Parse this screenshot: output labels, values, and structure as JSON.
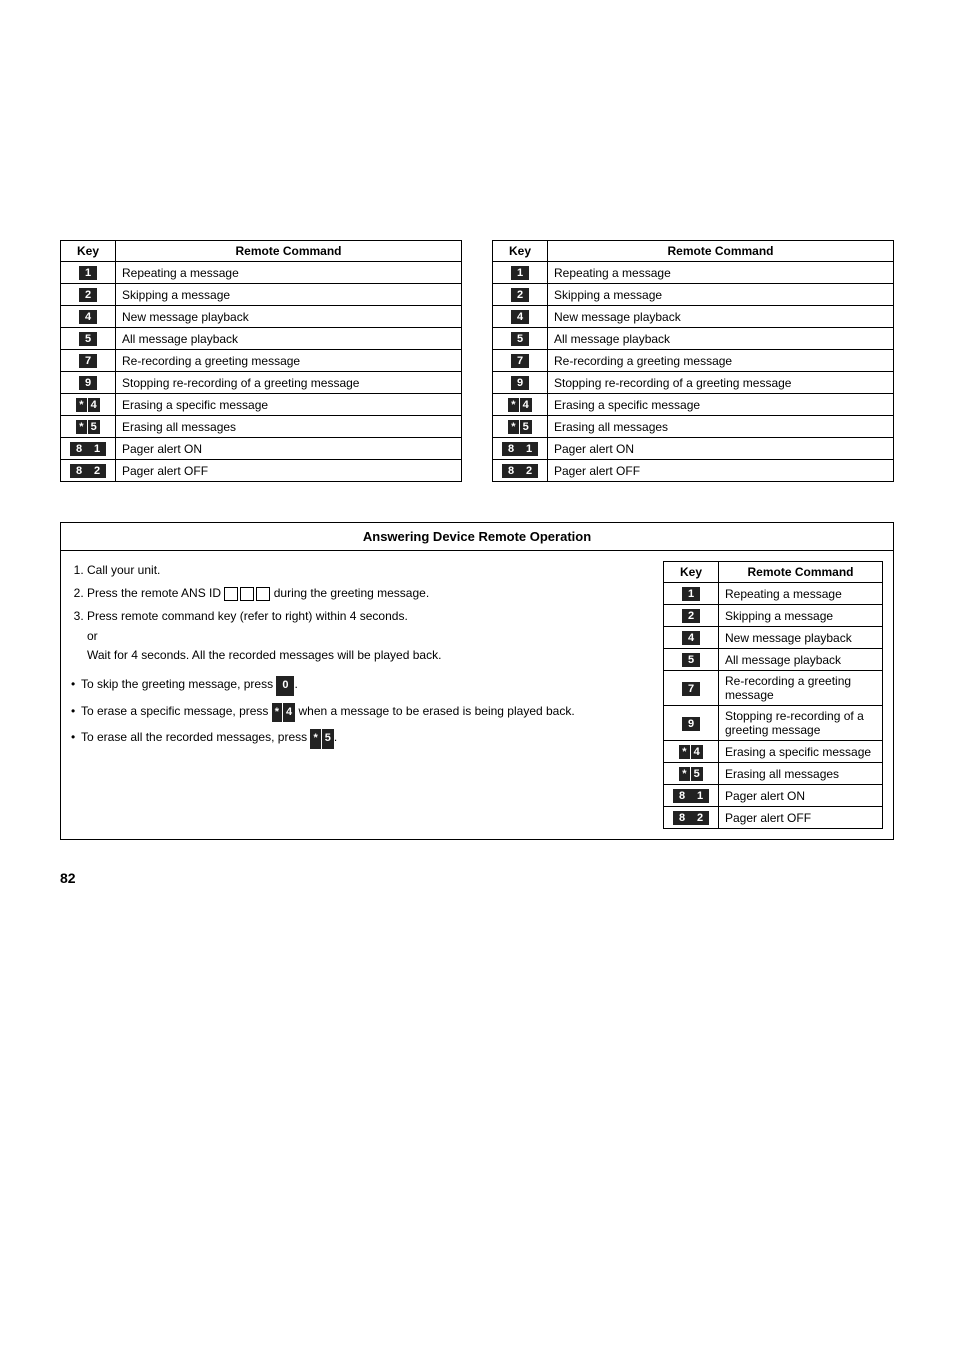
{
  "page": {
    "number": "82"
  },
  "table1": {
    "header_key": "Key",
    "header_command": "Remote Command",
    "rows": [
      {
        "key": "1",
        "command": "Repeating a message",
        "key_type": "single"
      },
      {
        "key": "2",
        "command": "Skipping a message",
        "key_type": "single"
      },
      {
        "key": "4",
        "command": "New message playback",
        "key_type": "single"
      },
      {
        "key": "5",
        "command": "All message playback",
        "key_type": "single"
      },
      {
        "key": "7",
        "command": "Re-recording a greeting message",
        "key_type": "single"
      },
      {
        "key": "9",
        "command": "Stopping re-recording of a greeting message",
        "key_type": "single"
      },
      {
        "key": "*4",
        "command": "Erasing a specific message",
        "key_type": "star"
      },
      {
        "key": "*5",
        "command": "Erasing all messages",
        "key_type": "star"
      },
      {
        "key": "81",
        "command": "Pager alert ON",
        "key_type": "double"
      },
      {
        "key": "82",
        "command": "Pager alert OFF",
        "key_type": "double"
      }
    ]
  },
  "table2": {
    "header_key": "Key",
    "header_command": "Remote Command",
    "rows": [
      {
        "key": "1",
        "command": "Repeating a message",
        "key_type": "single"
      },
      {
        "key": "2",
        "command": "Skipping a message",
        "key_type": "single"
      },
      {
        "key": "4",
        "command": "New message playback",
        "key_type": "single"
      },
      {
        "key": "5",
        "command": "All message playback",
        "key_type": "single"
      },
      {
        "key": "7",
        "command": "Re-recording a greeting message",
        "key_type": "single"
      },
      {
        "key": "9",
        "command": "Stopping re-recording of a greeting message",
        "key_type": "single"
      },
      {
        "key": "*4",
        "command": "Erasing a specific message",
        "key_type": "star"
      },
      {
        "key": "*5",
        "command": "Erasing all messages",
        "key_type": "star"
      },
      {
        "key": "81",
        "command": "Pager alert ON",
        "key_type": "double"
      },
      {
        "key": "82",
        "command": "Pager alert OFF",
        "key_type": "double"
      }
    ]
  },
  "answering_section": {
    "title": "Answering Device Remote Operation",
    "instructions": [
      "Call your unit.",
      "Press the remote ANS ID [___] during the greeting message.",
      "Press remote command key (refer to right) within 4 seconds.\nor\nWait for 4 seconds. All the recorded messages will be played back."
    ],
    "bullets": [
      "To skip the greeting message, press [0].",
      "To erase a specific message, press [*4] when a message to be erased is being played back.",
      "To erase all the recorded messages, press [*5]."
    ],
    "table": {
      "header_key": "Key",
      "header_command": "Remote Command",
      "rows": [
        {
          "key": "1",
          "command": "Repeating a message",
          "key_type": "single"
        },
        {
          "key": "2",
          "command": "Skipping a message",
          "key_type": "single"
        },
        {
          "key": "4",
          "command": "New message playback",
          "key_type": "single"
        },
        {
          "key": "5",
          "command": "All message playback",
          "key_type": "single"
        },
        {
          "key": "7",
          "command": "Re-recording a greeting message",
          "key_type": "single"
        },
        {
          "key": "9",
          "command": "Stopping re-recording of a greeting message",
          "key_type": "single"
        },
        {
          "key": "*4",
          "command": "Erasing a specific message",
          "key_type": "star"
        },
        {
          "key": "*5",
          "command": "Erasing all messages",
          "key_type": "star"
        },
        {
          "key": "81",
          "command": "Pager alert ON",
          "key_type": "double"
        },
        {
          "key": "82",
          "command": "Pager alert OFF",
          "key_type": "double"
        }
      ]
    }
  }
}
